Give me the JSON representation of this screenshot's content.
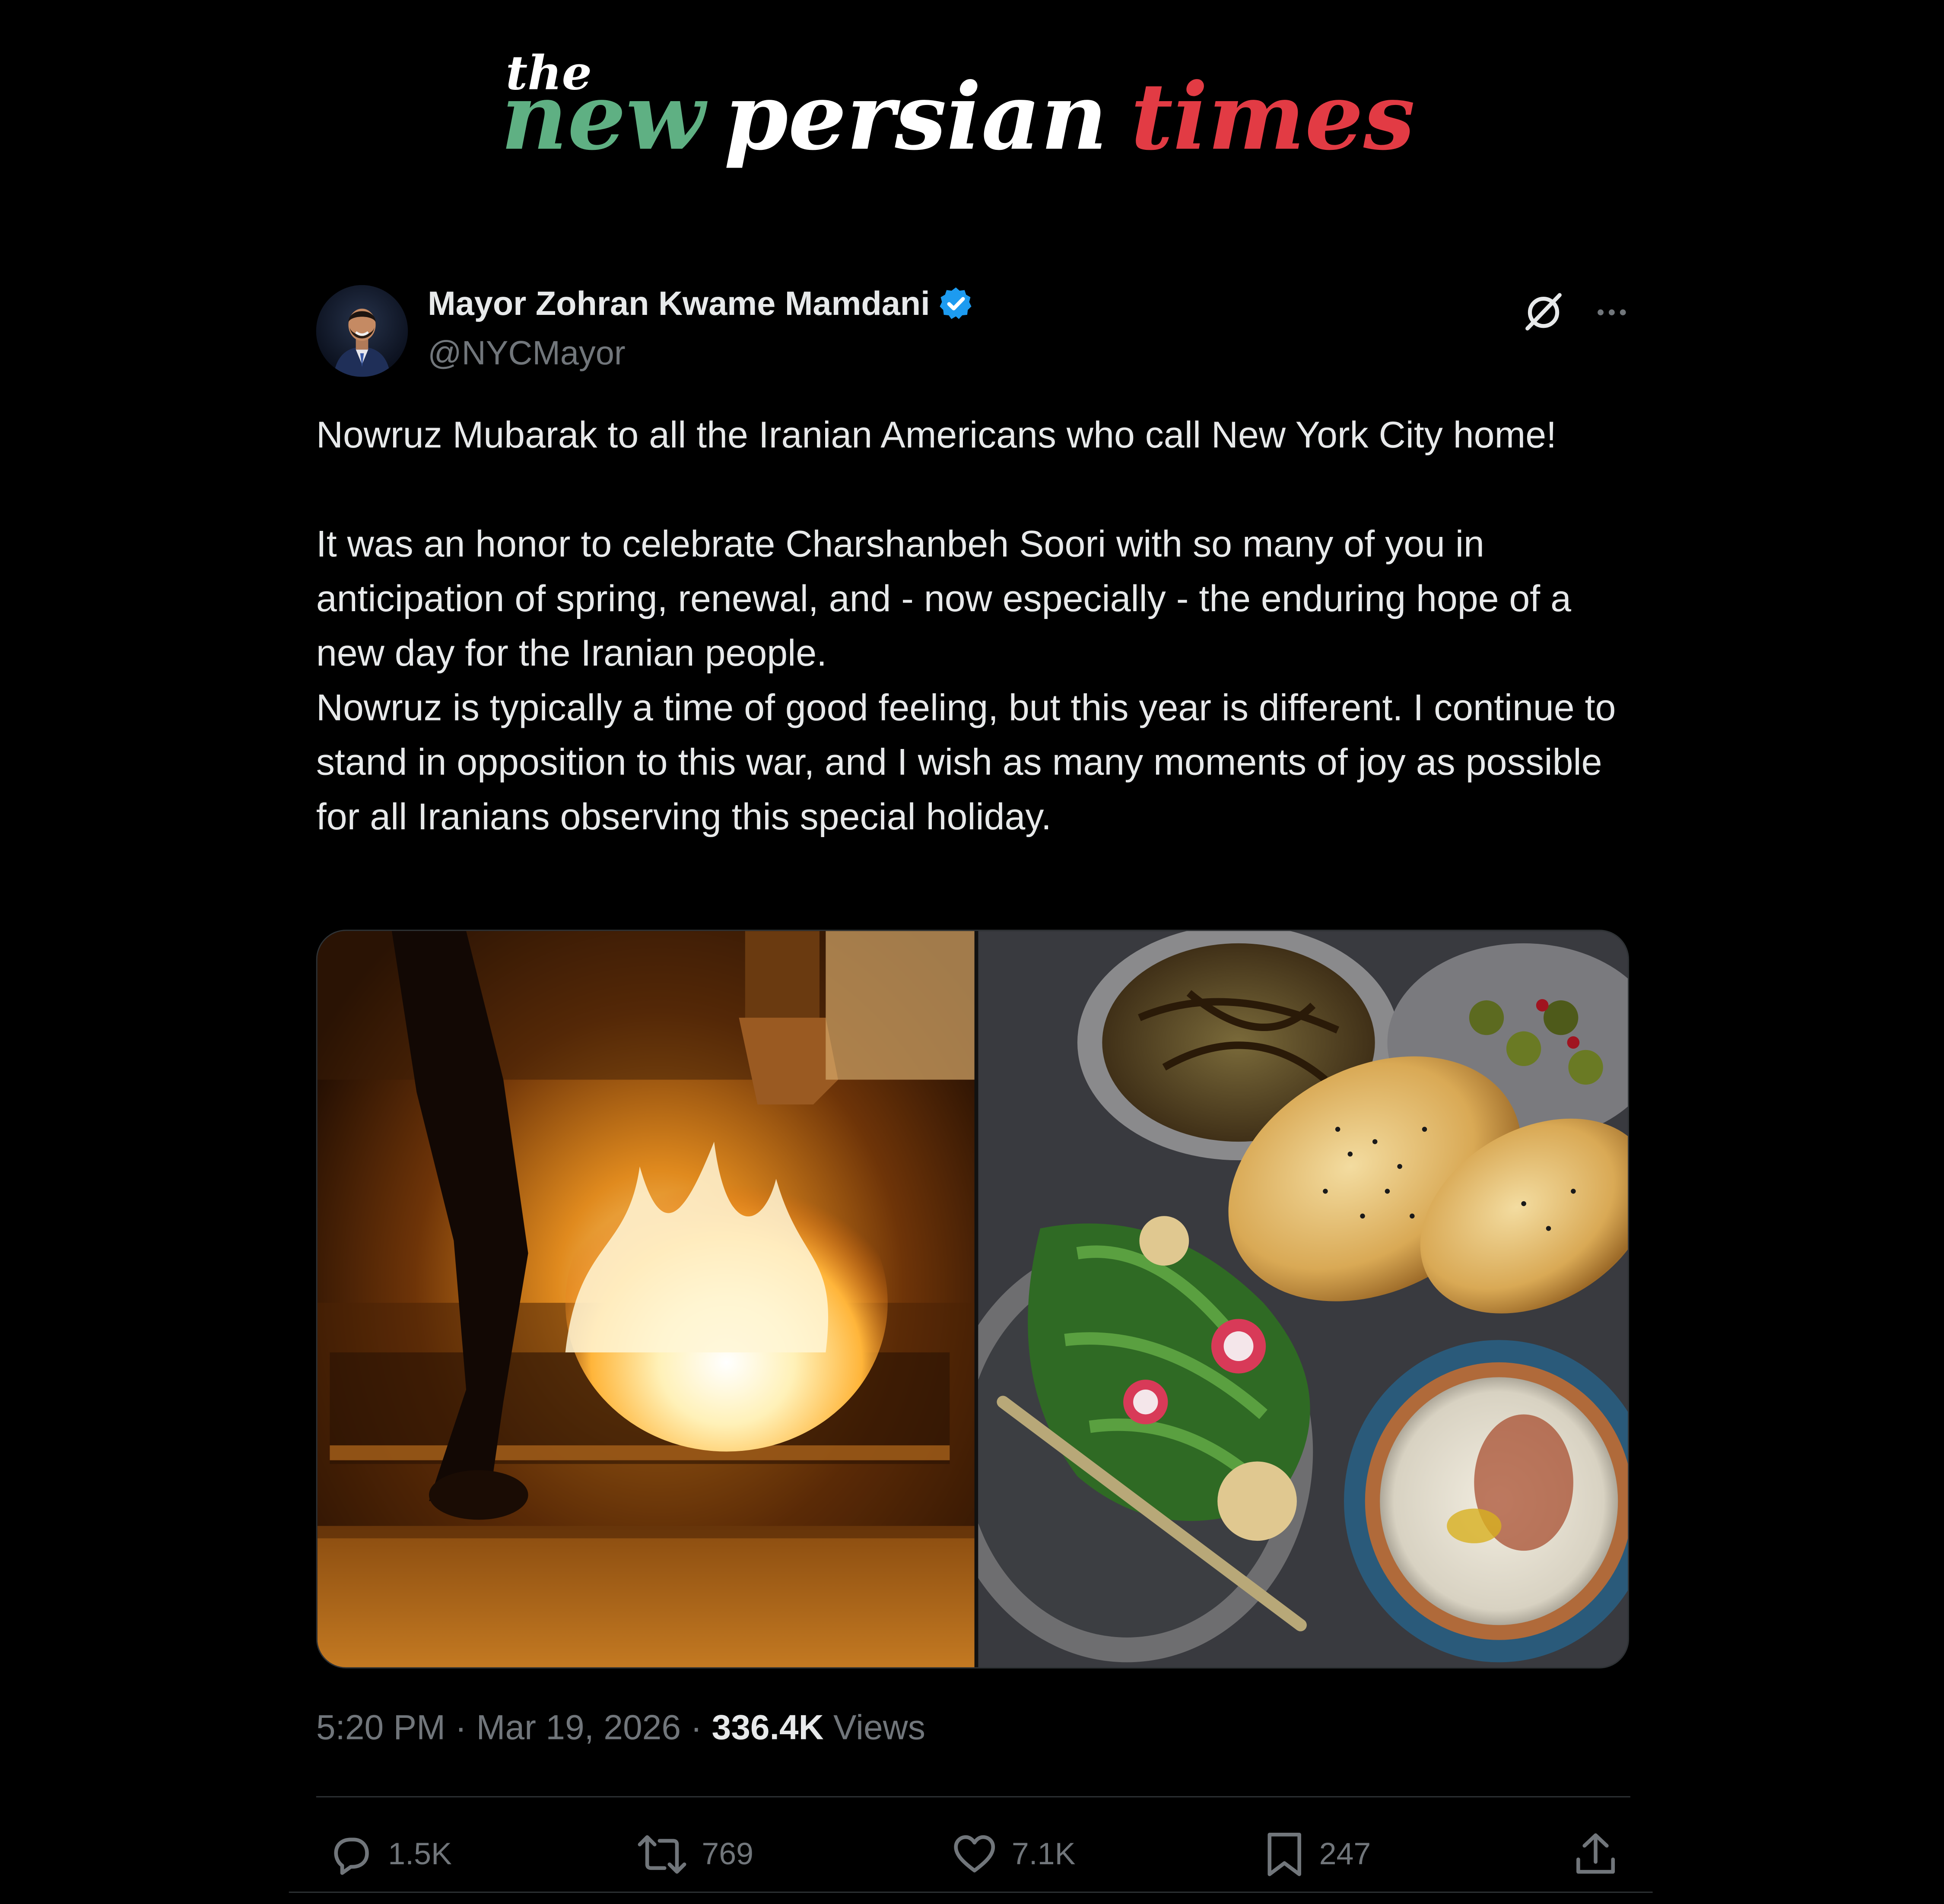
{
  "masthead": {
    "logo_small": "the",
    "logo_part1": "new",
    "logo_part2": "persian",
    "logo_part3": "times",
    "colors": {
      "new": "#5fb083",
      "persian": "#ffffff",
      "times": "#e23b44"
    }
  },
  "tweet": {
    "author": {
      "name": "Mayor Zohran Kwame Mamdani",
      "handle": "@NYCMayor",
      "verified_icon": "verified-badge-icon",
      "verified_color": "#1d9bf0"
    },
    "header_icons": [
      "grok-icon",
      "more-icon"
    ],
    "text": {
      "line1": "Nowruz Mubarak to all the Iranian Americans who call New York City home!",
      "line2": "It was an honor to celebrate Charshanbeh Soori with so many of you in anticipation of spring, renewal, and - now especially - the enduring hope of a new day for the Iranian people.",
      "line3": "Nowruz is typically a time of good feeling, but this year is different. I continue to stand in opposition to this war, and I wish as many moments of joy as possible for all Iranians observing this special holiday."
    },
    "media": [
      "bonfire-photo",
      "nowruz-food-photo"
    ],
    "meta": {
      "time": "5:20 PM",
      "separator": "·",
      "date": "Mar 19, 2026",
      "views_count": "336.4K",
      "views_label": "Views"
    },
    "actions": {
      "replies": "1.5K",
      "reposts": "769",
      "likes": "7.1K",
      "bookmarks": "247"
    }
  },
  "theme": {
    "background": "#000000",
    "text_primary": "#e7e9ea",
    "text_secondary": "#71767b",
    "border": "#2f3336"
  }
}
